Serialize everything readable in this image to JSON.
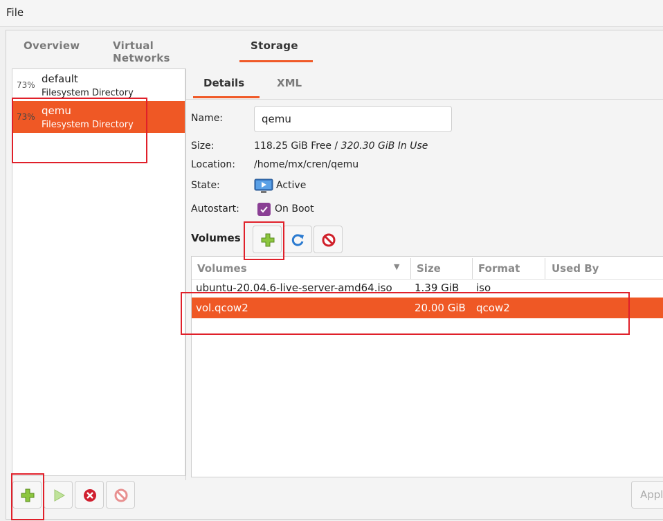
{
  "menu": {
    "file": "File"
  },
  "tabs": [
    {
      "label": "Overview",
      "active": false
    },
    {
      "label": "Virtual Networks",
      "active": false
    },
    {
      "label": "Storage",
      "active": true
    }
  ],
  "pools": [
    {
      "usage": "73%",
      "name": "default",
      "type": "Filesystem Directory",
      "selected": false
    },
    {
      "usage": "73%",
      "name": "qemu",
      "type": "Filesystem Directory",
      "selected": true
    }
  ],
  "detail_tabs": [
    {
      "label": "Details",
      "active": true
    },
    {
      "label": "XML",
      "active": false
    }
  ],
  "details": {
    "name_label": "Name:",
    "name_value": "qemu",
    "size_label": "Size:",
    "size_free": "118.25 GiB Free / ",
    "size_used": "320.30 GiB In Use",
    "location_label": "Location:",
    "location_value": "/home/mx/cren/qemu",
    "state_label": "State:",
    "state_value": "Active",
    "autostart_label": "Autostart:",
    "autostart_value": "On Boot",
    "autostart_checked": true
  },
  "volumes": {
    "section_label": "Volumes",
    "columns": [
      "Volumes",
      "Size",
      "Format",
      "Used By"
    ],
    "rows": [
      {
        "name": "ubuntu-20.04.6-live-server-amd64.iso",
        "size": "1.39 GiB",
        "format": "iso",
        "used_by": "",
        "selected": false
      },
      {
        "name": "vol.qcow2",
        "size": "20.00 GiB",
        "format": "qcow2",
        "used_by": "",
        "selected": true
      }
    ]
  },
  "footer": {
    "apply_label": "Appl"
  },
  "colors": {
    "accent": "#ef5825",
    "highlight_box": "#e0202a",
    "checkbox": "#8a3f94"
  }
}
